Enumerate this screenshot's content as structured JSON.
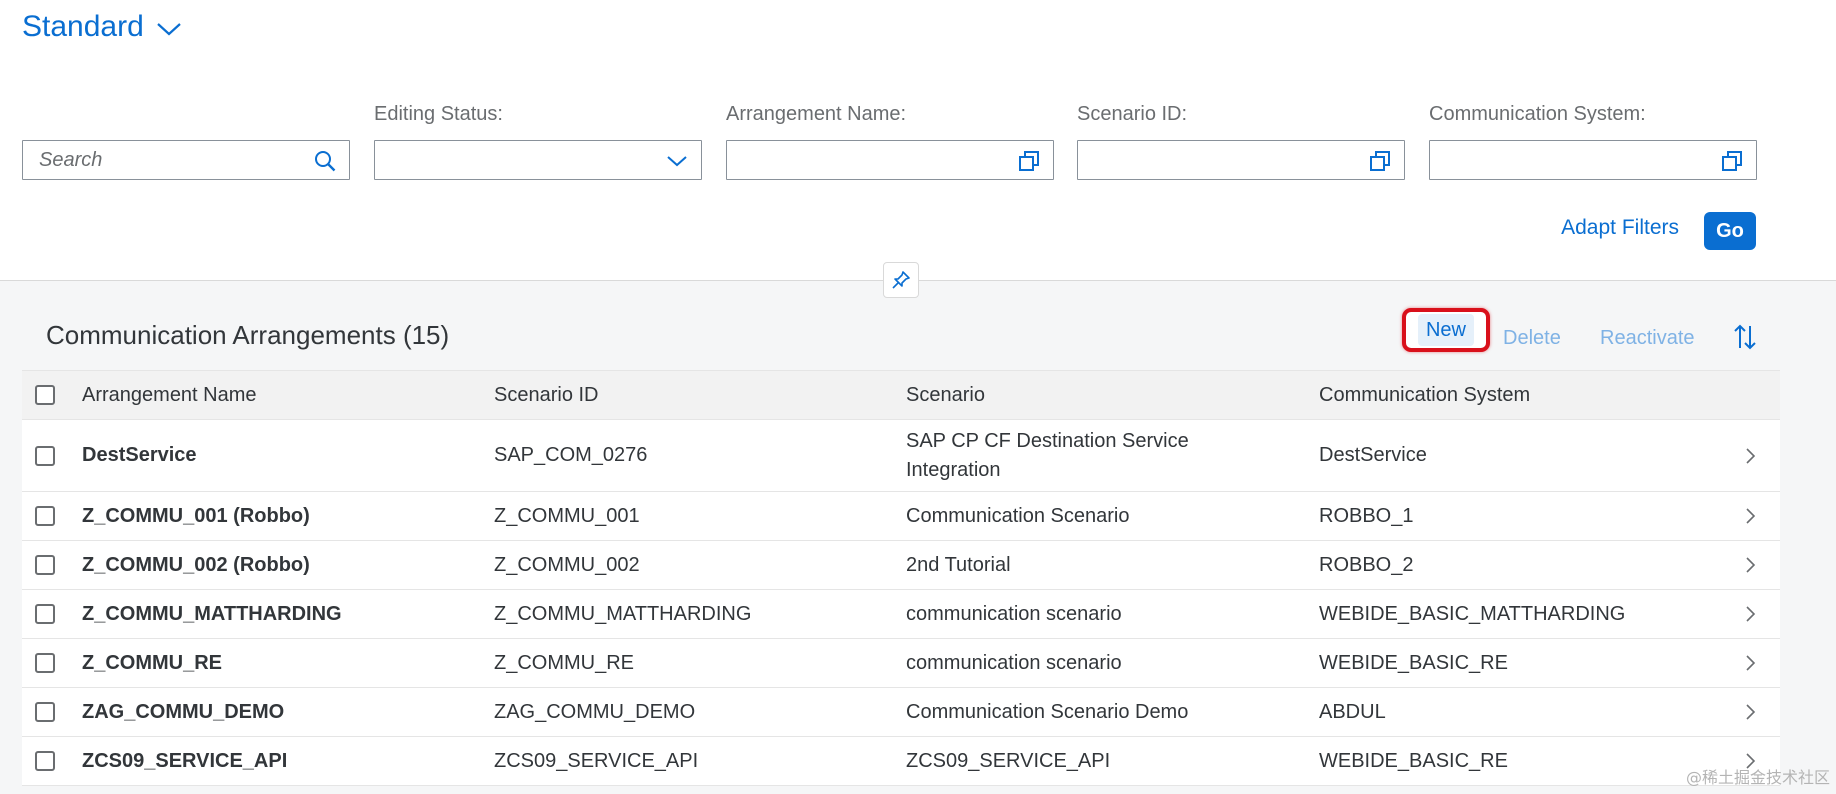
{
  "variant": {
    "title": "Standard"
  },
  "filters": {
    "search_placeholder": "Search",
    "editing_status_label": "Editing Status:",
    "arrangement_name_label": "Arrangement Name:",
    "scenario_id_label": "Scenario ID:",
    "communication_system_label": "Communication System:",
    "adapt_filters_label": "Adapt Filters",
    "go_label": "Go"
  },
  "table": {
    "title": "Communication Arrangements (15)",
    "toolbar": {
      "new_label": "New",
      "delete_label": "Delete",
      "reactivate_label": "Reactivate"
    },
    "columns": [
      "Arrangement Name",
      "Scenario ID",
      "Scenario",
      "Communication System"
    ],
    "rows": [
      [
        "DestService",
        "SAP_COM_0276",
        "SAP CP CF Destination Service Integration",
        "DestService"
      ],
      [
        "Z_COMMU_001 (Robbo)",
        "Z_COMMU_001",
        "Communication Scenario",
        "ROBBO_1"
      ],
      [
        "Z_COMMU_002 (Robbo)",
        "Z_COMMU_002",
        "2nd Tutorial",
        "ROBBO_2"
      ],
      [
        "Z_COMMU_MATTHARDING",
        "Z_COMMU_MATTHARDING",
        "communication scenario",
        "WEBIDE_BASIC_MATTHARDING"
      ],
      [
        "Z_COMMU_RE",
        "Z_COMMU_RE",
        "communication scenario",
        "WEBIDE_BASIC_RE"
      ],
      [
        "ZAG_COMMU_DEMO",
        "ZAG_COMMU_DEMO",
        "Communication Scenario Demo",
        "ABDUL"
      ],
      [
        "ZCS09_SERVICE_API",
        "ZCS09_SERVICE_API",
        "ZCS09_SERVICE_API",
        "WEBIDE_BASIC_RE"
      ]
    ]
  },
  "watermark": "@稀土掘金技术社区",
  "colors": {
    "accent": "#0a6ed1",
    "highlight_border": "#d9101b",
    "disabled_text": "#7fb2e5",
    "header_bg": "#ffffff",
    "page_bg": "#f5f6f7"
  },
  "icons": {
    "variant_toggle": "chevron-down-icon",
    "search": "search-icon",
    "dropdown": "chevron-down-icon",
    "value_help": "value-help-icon",
    "pin": "pin-icon",
    "sort": "sort-icon",
    "row_nav": "chevron-right-icon"
  }
}
